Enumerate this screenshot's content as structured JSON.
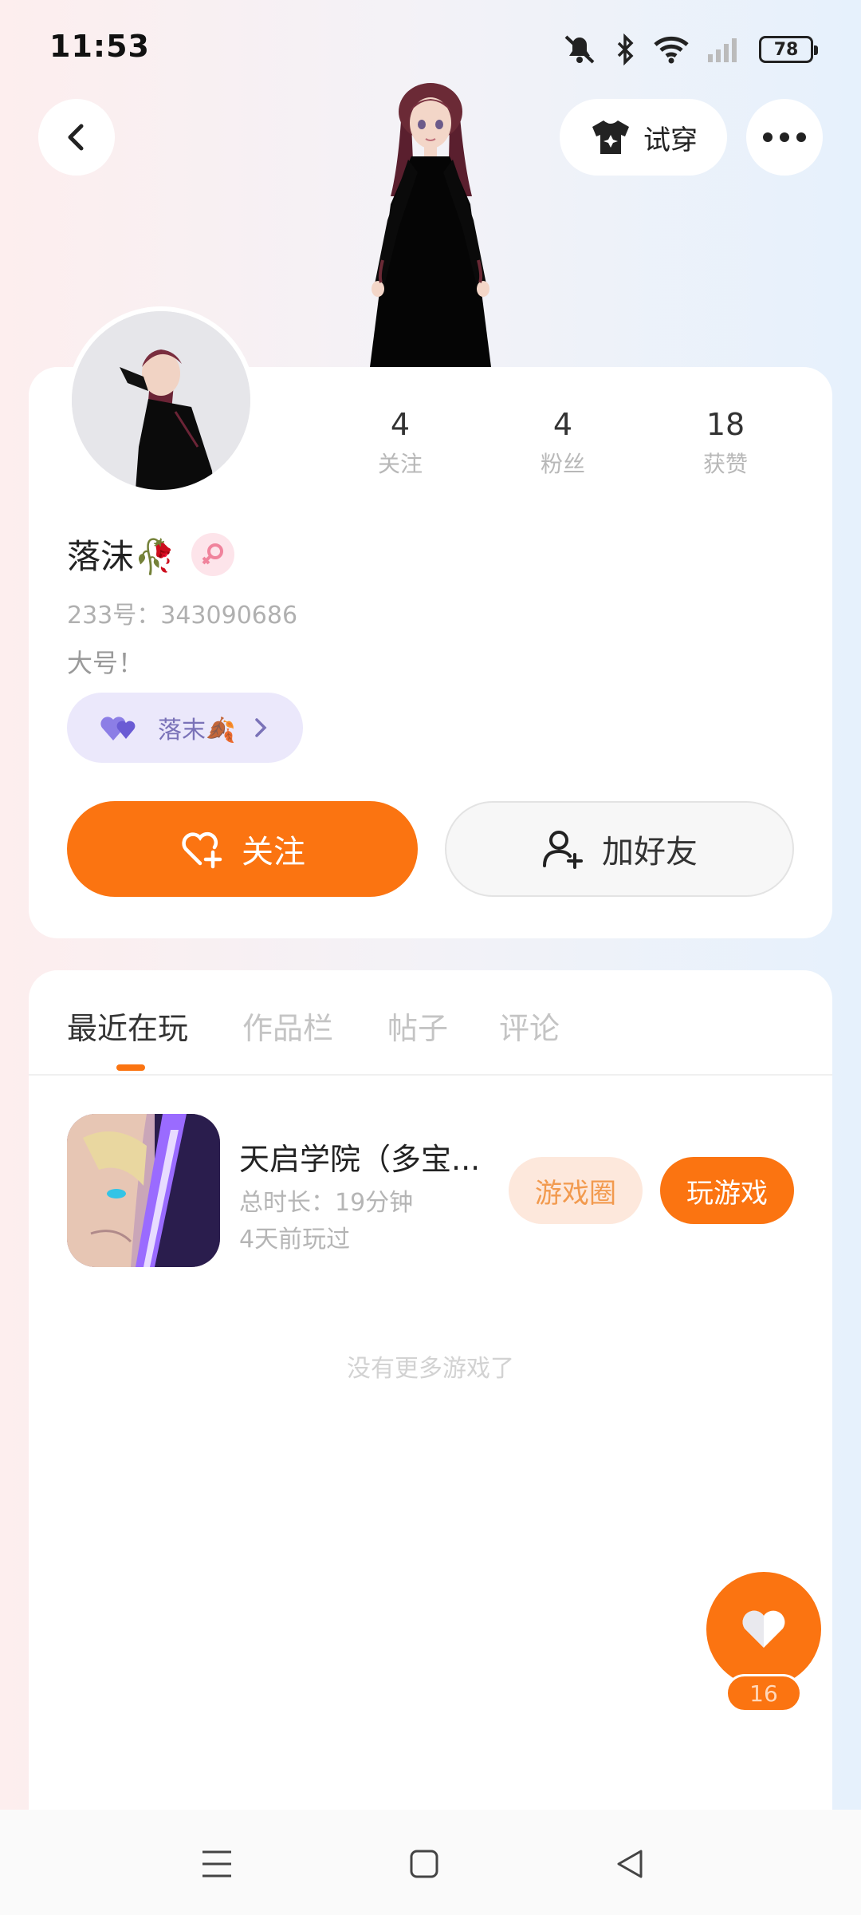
{
  "status_bar": {
    "time": "11:53",
    "battery": "78"
  },
  "top_actions": {
    "tryon_label": "试穿"
  },
  "profile": {
    "nickname": "落沫🥀",
    "uid_label": "233号：343090686",
    "bio": "大号！",
    "couple_label": "落末🍂",
    "stats": [
      {
        "num": "4",
        "label": "关注"
      },
      {
        "num": "4",
        "label": "粉丝"
      },
      {
        "num": "18",
        "label": "获赞"
      }
    ],
    "follow_label": "关注",
    "add_friend_label": "加好友"
  },
  "tabs": [
    {
      "label": "最近在玩",
      "active": true
    },
    {
      "label": "作品栏",
      "active": false
    },
    {
      "label": "帖子",
      "active": false
    },
    {
      "label": "评论",
      "active": false
    }
  ],
  "recent_games": [
    {
      "title": "天启学院（多宝...",
      "duration": "总时长：19分钟",
      "last_played": "4天前玩过",
      "circle_label": "游戏圈",
      "play_label": "玩游戏"
    }
  ],
  "no_more_text": "没有更多游戏了",
  "like_count": "16",
  "colors": {
    "accent": "#fb7411",
    "couple_chip_bg": "#ebe8fb",
    "game_circle_bg": "#fde8dc"
  },
  "icons": {
    "back": "chevron-left-icon",
    "tryon": "tshirt-icon",
    "more": "more-dots-icon",
    "gender": "female-icon",
    "couple": "double-heart-icon",
    "follow": "heart-plus-icon",
    "add_friend": "person-add-icon",
    "like": "heart-icon"
  }
}
